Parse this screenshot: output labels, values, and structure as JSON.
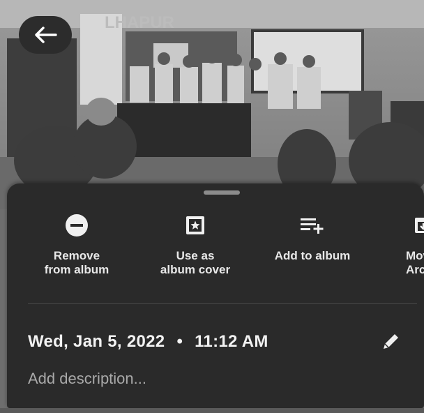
{
  "photo": {
    "back_icon": "arrow-left-icon",
    "watermark_text": "LHAPUR"
  },
  "sheet": {
    "actions": [
      {
        "label": "Remove\nfrom album",
        "icon": "remove-circle-icon"
      },
      {
        "label": "Use as\nalbum cover",
        "icon": "album-cover-icon"
      },
      {
        "label": "Add to album",
        "icon": "playlist-add-icon"
      },
      {
        "label": "Mov\nArc",
        "icon": "move-to-archive-icon"
      }
    ],
    "date": "Wed, Jan 5, 2022",
    "separator": "•",
    "time": "11:12 AM",
    "edit_icon": "pencil-icon",
    "description_placeholder": "Add description..."
  }
}
